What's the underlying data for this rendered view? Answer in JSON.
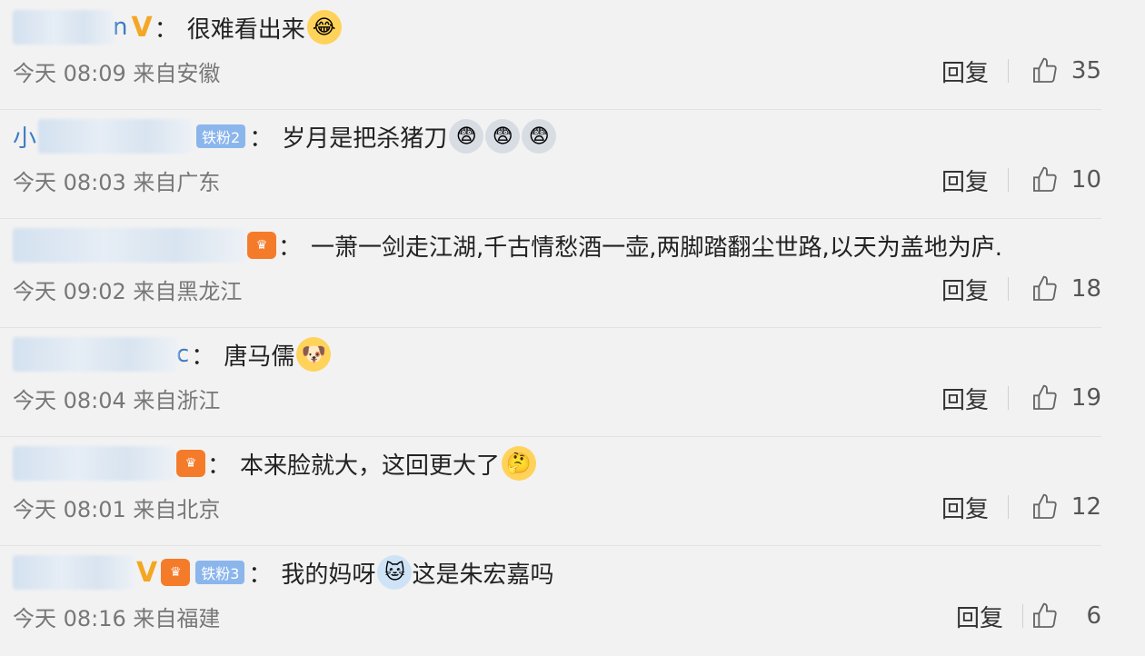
{
  "comments": [
    {
      "name_suffix": "n",
      "badges": [
        "V"
      ],
      "colon": "：",
      "text": "很难看出来",
      "emojis": [
        "😂"
      ],
      "meta": "今天 08:09 来自安徽",
      "reply": "回复",
      "likes": "35"
    },
    {
      "name_suffix": "小",
      "badges": [
        "铁粉2"
      ],
      "colon": "：",
      "text": "岁月是把杀猪刀",
      "emojis": [
        "😨",
        "😨",
        "😨"
      ],
      "meta": "今天 08:03 来自广东",
      "reply": "回复",
      "likes": "10"
    },
    {
      "name_suffix": "",
      "badges": [
        "crown"
      ],
      "colon": "：",
      "text": "一萧一剑走江湖,千古情愁酒一壶,两脚踏翻尘世路,以天为盖地为庐.",
      "emojis": [],
      "meta": "今天 09:02 来自黑龙江",
      "reply": "回复",
      "likes": "18"
    },
    {
      "name_suffix": "c",
      "badges": [],
      "colon": "：",
      "text": "唐马儒",
      "emojis": [
        "🐶"
      ],
      "meta": "今天 08:04 来自浙江",
      "reply": "回复",
      "likes": "19"
    },
    {
      "name_suffix": "",
      "badges": [
        "crown"
      ],
      "colon": "：",
      "text": "本来脸就大，这回更大了",
      "emojis": [
        "🤔"
      ],
      "meta": "今天 08:01 来自北京",
      "reply": "回复",
      "likes": "12"
    },
    {
      "name_suffix": "",
      "badges": [
        "V",
        "crown",
        "铁粉3"
      ],
      "colon": "：",
      "text_before": "我的妈呀",
      "emojis": [
        "🐱"
      ],
      "text_after": "这是朱宏嘉吗",
      "meta": "今天 08:16 来自福建",
      "reply": "回复",
      "likes": "6"
    }
  ],
  "icons": {
    "like": "thumbs-up-icon",
    "crown": "crown-badge-icon",
    "vip": "v-badge-icon"
  },
  "colors": {
    "background": "#f2f2f2",
    "text": "#222222",
    "meta": "#777777",
    "v_badge": "#f5a623",
    "fan_badge": "#8bb6ec"
  }
}
